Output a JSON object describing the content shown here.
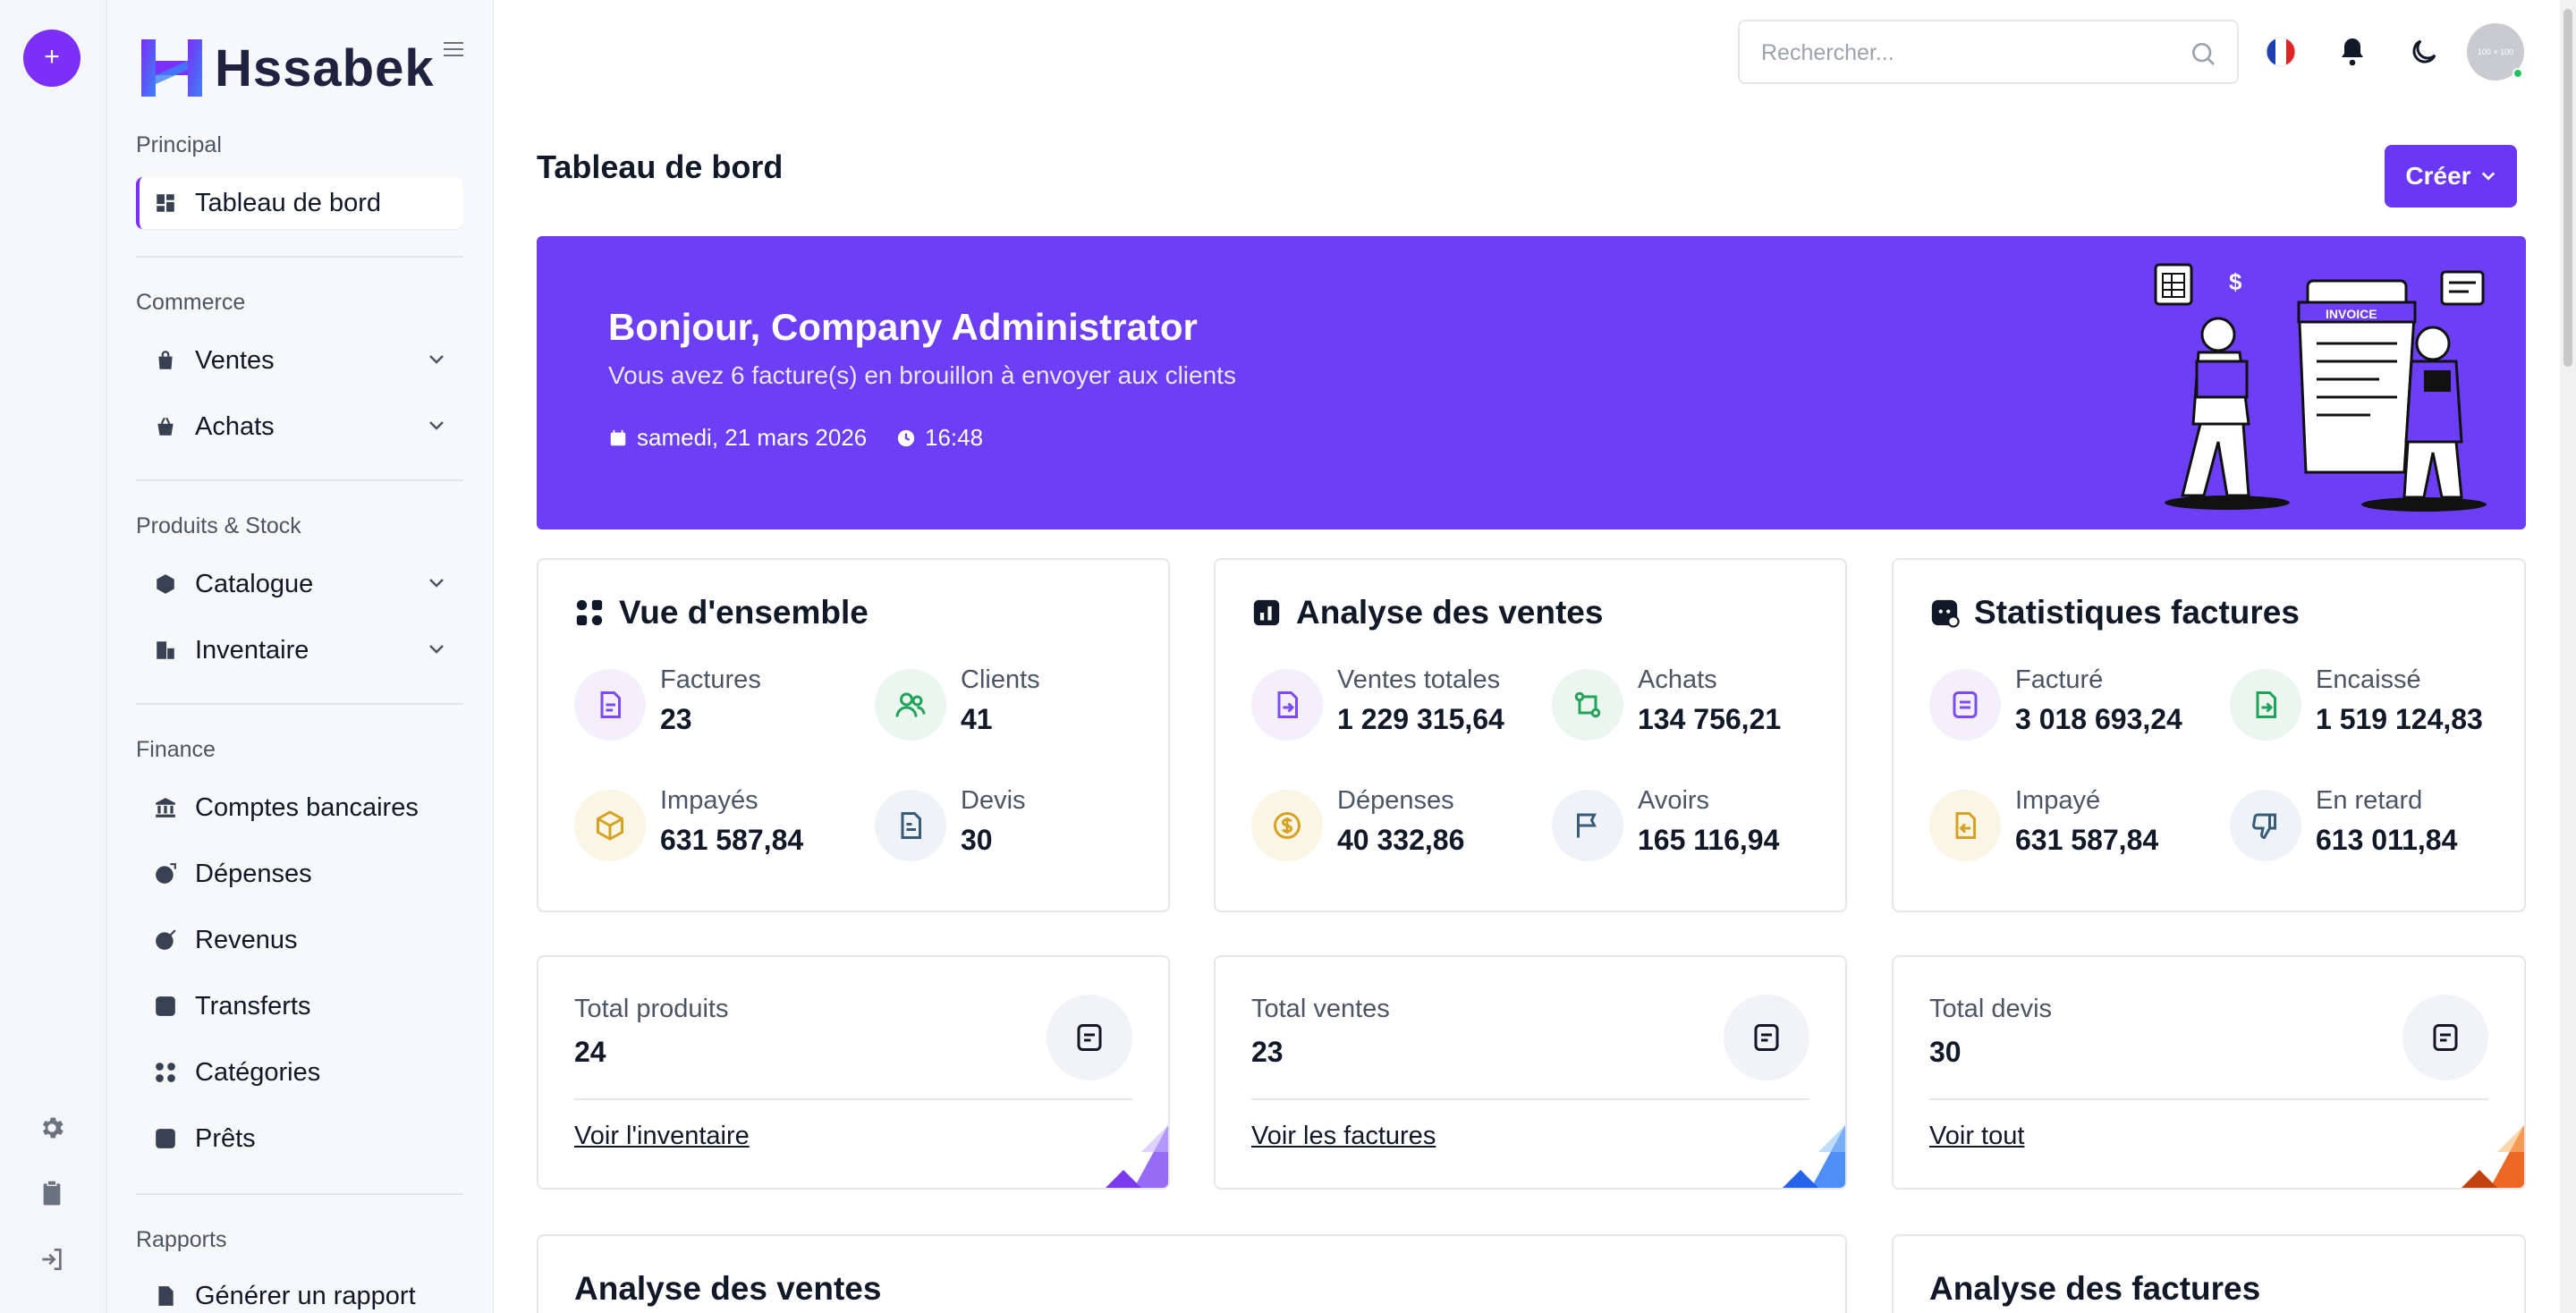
{
  "app": {
    "name": "Hssabek"
  },
  "search": {
    "placeholder": "Rechercher..."
  },
  "avatar": {
    "text": "100 × 100"
  },
  "sidebar": {
    "sections": [
      {
        "label": "Principal"
      },
      {
        "label": "Commerce"
      },
      {
        "label": "Produits & Stock"
      },
      {
        "label": "Finance"
      },
      {
        "label": "Rapports"
      }
    ],
    "items": [
      {
        "label": "Tableau de bord"
      },
      {
        "label": "Ventes"
      },
      {
        "label": "Achats"
      },
      {
        "label": "Catalogue"
      },
      {
        "label": "Inventaire"
      },
      {
        "label": "Comptes bancaires"
      },
      {
        "label": "Dépenses"
      },
      {
        "label": "Revenus"
      },
      {
        "label": "Transferts"
      },
      {
        "label": "Catégories"
      },
      {
        "label": "Prêts"
      },
      {
        "label": "Générer un rapport"
      }
    ]
  },
  "header": {
    "title": "Tableau de bord",
    "create_label": "Créer"
  },
  "banner": {
    "greeting": "Bonjour, Company Administrator",
    "subtitle": "Vous avez 6 facture(s) en brouillon à envoyer aux clients",
    "date": "samedi, 21 mars 2026",
    "time": "16:48",
    "illustration_text": "INVOICE"
  },
  "overview": {
    "title": "Vue d'ensemble",
    "stats": [
      {
        "label": "Factures",
        "value": "23"
      },
      {
        "label": "Clients",
        "value": "41"
      },
      {
        "label": "Impayés",
        "value": "631 587,84"
      },
      {
        "label": "Devis",
        "value": "30"
      }
    ]
  },
  "sales": {
    "title": "Analyse des ventes",
    "stats": [
      {
        "label": "Ventes totales",
        "value": "1 229 315,64"
      },
      {
        "label": "Achats",
        "value": "134 756,21"
      },
      {
        "label": "Dépenses",
        "value": "40 332,86"
      },
      {
        "label": "Avoirs",
        "value": "165 116,94"
      }
    ]
  },
  "invoices": {
    "title": "Statistiques factures",
    "stats": [
      {
        "label": "Facturé",
        "value": "3 018 693,24"
      },
      {
        "label": "Encaissé",
        "value": "1 519 124,83"
      },
      {
        "label": "Impayé",
        "value": "631 587,84"
      },
      {
        "label": "En retard",
        "value": "613 011,84"
      }
    ]
  },
  "totals": [
    {
      "label": "Total produits",
      "value": "24",
      "link": "Voir l'inventaire"
    },
    {
      "label": "Total ventes",
      "value": "23",
      "link": "Voir les factures"
    },
    {
      "label": "Total devis",
      "value": "30",
      "link": "Voir tout"
    }
  ],
  "bottom": {
    "sales_title": "Analyse des ventes",
    "invoices_title": "Analyse des factures"
  },
  "colors": {
    "accent": "#6c3ef5",
    "button": "#6a38f4",
    "rail_add": "#7b2ff7"
  }
}
